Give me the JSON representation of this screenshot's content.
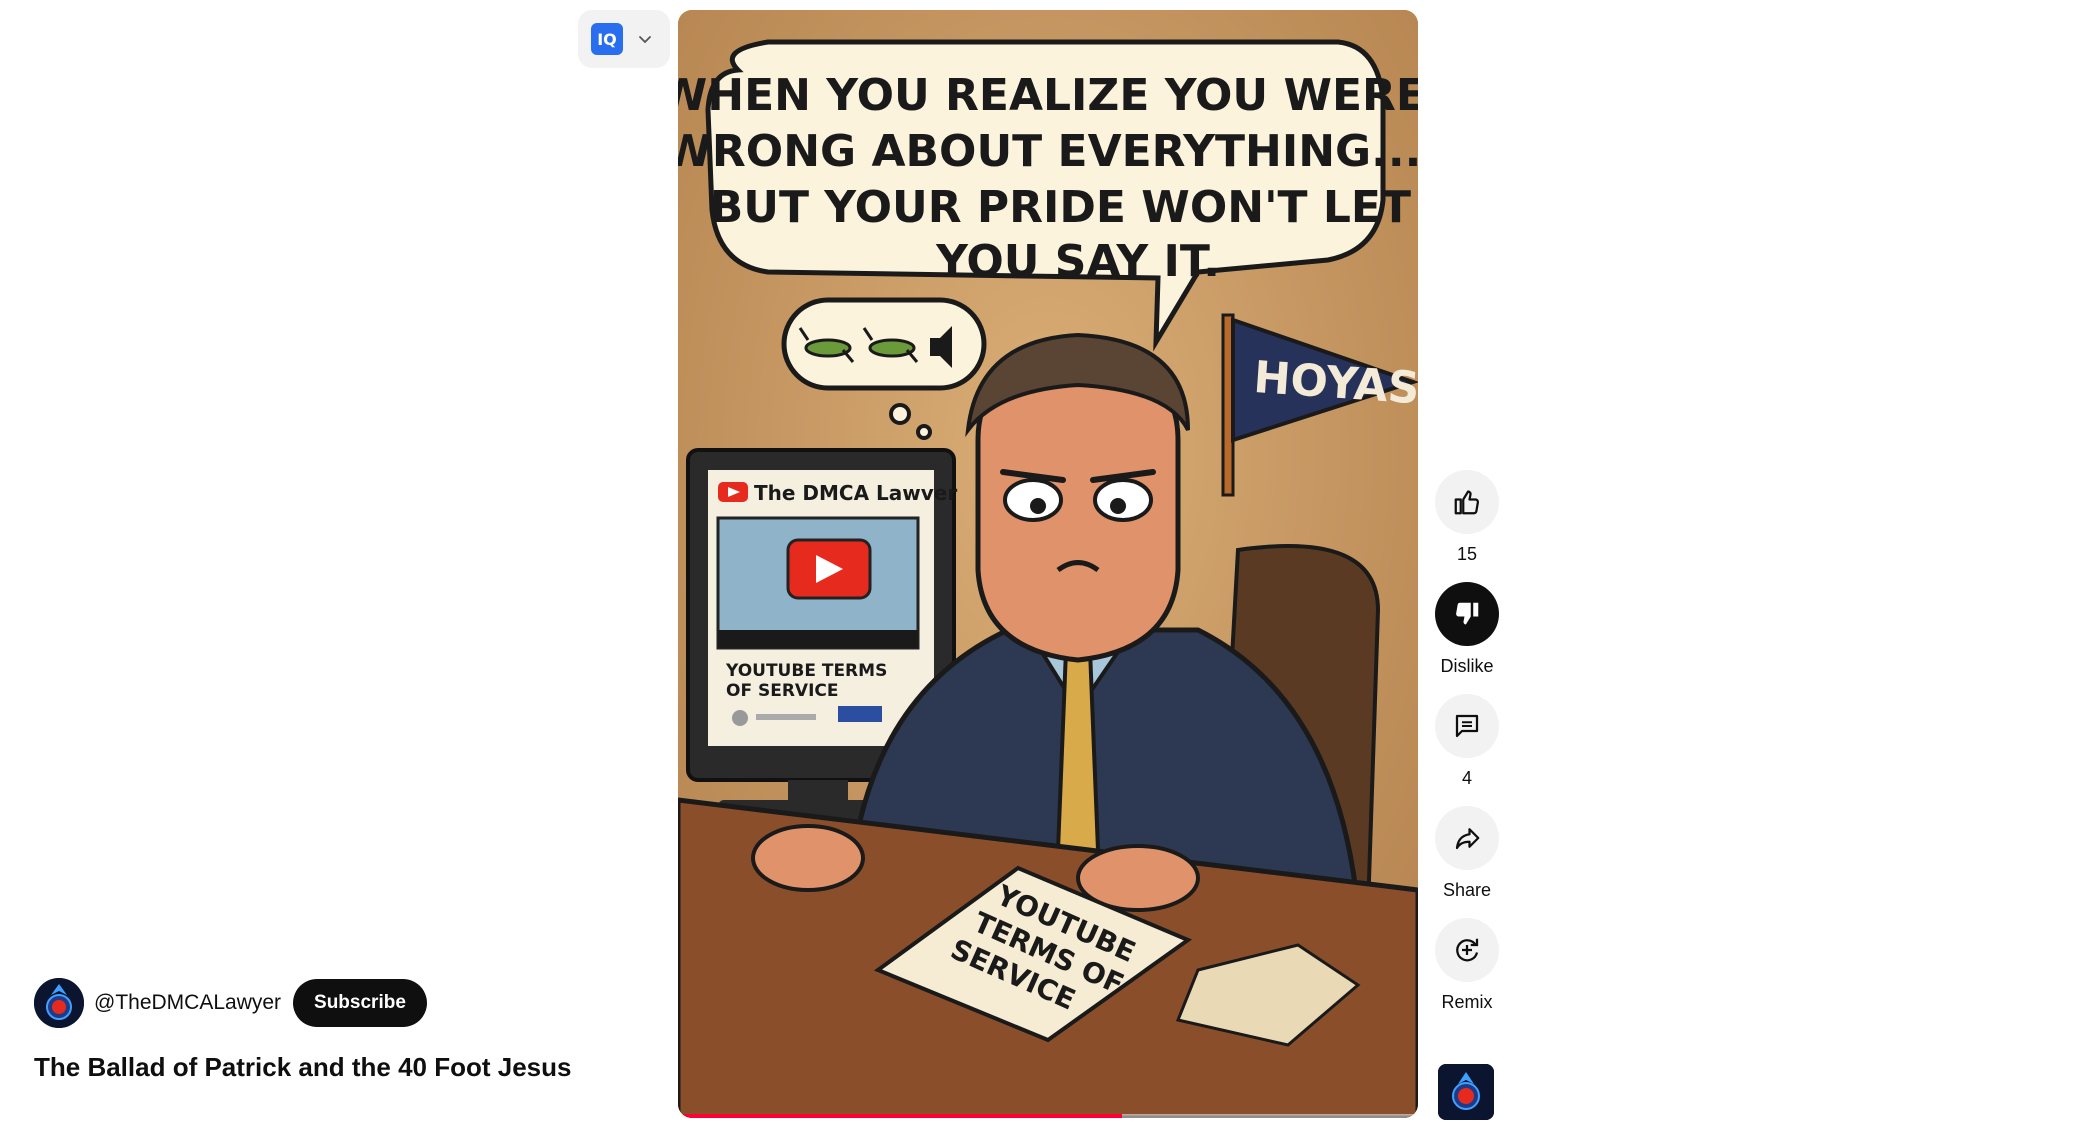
{
  "extension": {
    "logo_text": "IQ",
    "icon": "chevron-down-icon"
  },
  "video": {
    "speech_bubble_text": "WHEN YOU REALIZE YOU WERE\nWRONG ABOUT EVERYTHING...\nBUT YOUR PRIDE WON'T LET\nYOU SAY IT.",
    "pennant_text": "HOYAS",
    "monitor_channel": "The DMCA Lawver",
    "monitor_caption": "YOUTUBE TERMS\nOF SERVICE",
    "paper_text": "YOUTUBE\nTERMS OF\nSERVICE",
    "progress_fraction": 0.6
  },
  "actions": {
    "like": {
      "icon": "thumbs-up-icon",
      "label": "15"
    },
    "dislike": {
      "icon": "thumbs-down-icon",
      "label": "Dislike"
    },
    "comments": {
      "icon": "comment-icon",
      "label": "4"
    },
    "share": {
      "icon": "share-icon",
      "label": "Share"
    },
    "remix": {
      "icon": "remix-icon",
      "label": "Remix"
    }
  },
  "channel": {
    "handle": "@TheDMCALawyer",
    "subscribe_label": "Subscribe"
  },
  "short_title": "The Ballad of Patrick and the 40 Foot Jesus",
  "colors": {
    "accent_red": "#ff0033",
    "button_dark": "#0f0f0f",
    "button_light": "#f2f2f2"
  }
}
